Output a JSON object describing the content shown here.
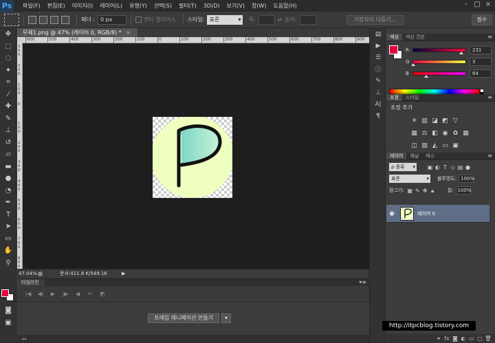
{
  "app": {
    "logo": "Ps",
    "menu": [
      "파일(F)",
      "편집(E)",
      "이미지(I)",
      "레이어(L)",
      "유형(Y)",
      "선택(S)",
      "필터(T)",
      "3D(D)",
      "보기(V)",
      "창(W)",
      "도움말(H)"
    ],
    "window_controls": [
      "-",
      "□",
      "×"
    ]
  },
  "options": {
    "feather_label": "페더 :",
    "feather_value": "0 px",
    "antialias_label": "앤티 앨리어스",
    "style_label": "스타일:",
    "style_value": "표준",
    "width_label": "폭:",
    "height_label": "높이:",
    "refine_edge": "가장자리 다듬기...",
    "workspace": "필수"
  },
  "document": {
    "tab_title": "무제1.png @ 47% (레이어 0, RGB/8) *",
    "close": "×",
    "zoom": "47.04%",
    "doc_info": "문서:411.8 K/549.1K",
    "ruler_h": [
      "600",
      "500",
      "400",
      "300",
      "200",
      "100",
      "0",
      "100",
      "200",
      "300",
      "400",
      "500",
      "600",
      "700",
      "800",
      "900"
    ],
    "ruler_v": [
      "300",
      "200",
      "100",
      "0",
      "100",
      "200",
      "300",
      "400",
      "500",
      "600",
      "700",
      "800"
    ]
  },
  "timeline": {
    "tab": "타임라인",
    "create_button": "프레임 애니메이션 만들기",
    "dropdown": "▾"
  },
  "color_panel": {
    "tabs": [
      "색상",
      "색상 견본"
    ],
    "r": 231,
    "g": 3,
    "b": 64,
    "labels": [
      "R",
      "G",
      "B"
    ],
    "foreground": "#e7033f",
    "background": "#ffffff"
  },
  "adjustments_panel": {
    "tabs": [
      "조정",
      "스타일"
    ],
    "title": "조정 추가"
  },
  "layers_panel": {
    "tabs": [
      "레이어",
      "채널",
      "패스"
    ],
    "filter": "ρ 종류",
    "blend_mode": "표준",
    "opacity_label": "불투명도:",
    "opacity": "100%",
    "lock_label": "잠그기:",
    "fill_label": "칠:",
    "fill": "100%",
    "layer_name": "레이어 0"
  },
  "artwork": {
    "circle_color": "#eeffc0",
    "letter_gradient": [
      "#7cd6c6",
      "#c6f2d8"
    ]
  },
  "watermark": "http://itpcblog.tistory.com"
}
